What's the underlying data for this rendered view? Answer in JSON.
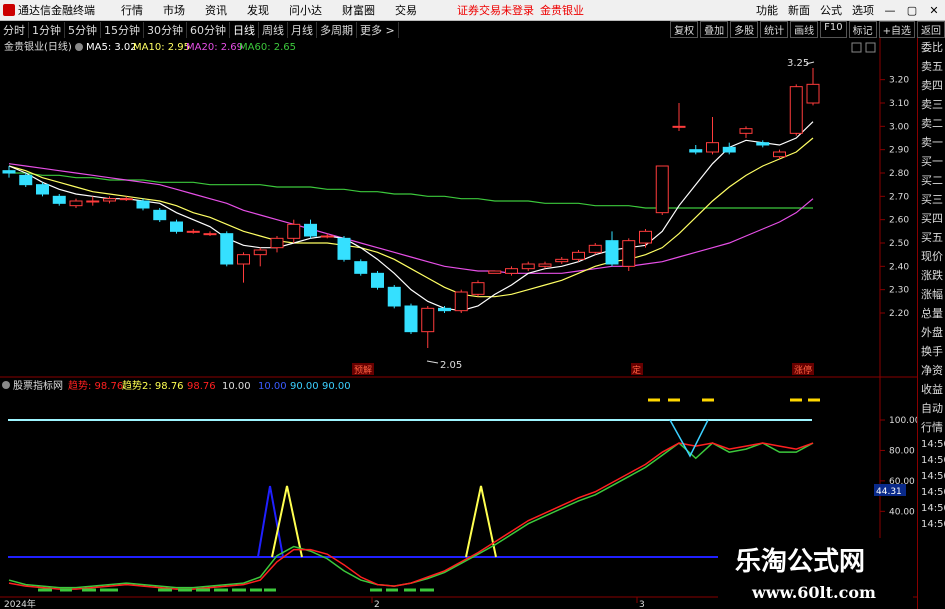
{
  "menubar": {
    "app_name": "通达信金融终端",
    "menus": [
      "行情",
      "市场",
      "资讯",
      "发现",
      "问小达",
      "财富圈",
      "交易"
    ],
    "alert": "证券交易未登录",
    "stock": "金贵银业",
    "right_menus": [
      "功能",
      "新面",
      "公式",
      "选项"
    ],
    "win_min": "—",
    "win_max": "▢",
    "win_close": "✕"
  },
  "periodbar": {
    "periods": [
      "分时",
      "1分钟",
      "5分钟",
      "15分钟",
      "30分钟",
      "60分钟",
      "日线",
      "周线",
      "月线",
      "多周期",
      "更多 >"
    ],
    "active": "日线",
    "right_tools": [
      "复权",
      "叠加",
      "多股",
      "统计",
      "画线",
      "F10",
      "标记",
      "+自选",
      "返回"
    ]
  },
  "main_chart_header": {
    "title": "金贵银业(日线)",
    "ma5": "MA5: 3.02",
    "ma10": "MA10: 2.95",
    "ma20": "MA20: 2.69",
    "ma60": "MA60: 2.65"
  },
  "main_chart_labels": {
    "high_marker": "3.25",
    "low_marker": "2.05",
    "tag1": "预解",
    "tag2": "定",
    "tag3": "涨停"
  },
  "price_axis": [
    "3.20",
    "3.10",
    "3.00",
    "2.90",
    "2.80",
    "2.70",
    "2.60",
    "2.50",
    "2.40",
    "2.30",
    "2.20"
  ],
  "indicator_header": {
    "title": "股票指标网",
    "t1_label": "趋势: 98.76",
    "t2_label": "趋势2: 98.76",
    "v1": "98.76",
    "v2": "10.00",
    "v3": "10.00",
    "v4": "90.00",
    "v5": "90.00"
  },
  "indicator_axis": [
    "100.00",
    "80.00",
    "60.00",
    "40.00"
  ],
  "indicator_readout": "44.31",
  "time_axis": [
    "2024年",
    "2",
    "3"
  ],
  "side_panel": {
    "top": "委比",
    "items": [
      "卖五",
      "卖四",
      "卖三",
      "卖二",
      "卖一",
      "买一",
      "买二",
      "买三",
      "买四",
      "买五",
      "现价",
      "涨跌",
      "涨幅",
      "总量",
      "外盘",
      "换手",
      "净资",
      "收益"
    ],
    "lower": [
      "自动",
      "行情"
    ],
    "times": [
      "14:50",
      "14:50",
      "14:50",
      "14:50",
      "14:50",
      "14:50"
    ]
  },
  "watermark": {
    "title": "乐淘公式网",
    "url": "www.60lt.com"
  },
  "colors": {
    "up": "#ff3c3c",
    "down": "#35e0ff",
    "ma5": "#ffffff",
    "ma10": "#ffff64",
    "ma20": "#e64fe6",
    "ma60": "#3cc83c",
    "trend": "#ff2020",
    "trend2": "#ffff50"
  },
  "chart_data": {
    "type": "candlestick",
    "price_range": [
      2.05,
      3.25
    ],
    "ohlc": [
      [
        2.81,
        2.83,
        2.78,
        2.8
      ],
      [
        2.79,
        2.8,
        2.74,
        2.75
      ],
      [
        2.75,
        2.76,
        2.7,
        2.71
      ],
      [
        2.7,
        2.71,
        2.66,
        2.67
      ],
      [
        2.66,
        2.69,
        2.65,
        2.68
      ],
      [
        2.68,
        2.7,
        2.66,
        2.68
      ],
      [
        2.68,
        2.7,
        2.67,
        2.69
      ],
      [
        2.69,
        2.7,
        2.68,
        2.69
      ],
      [
        2.68,
        2.69,
        2.64,
        2.65
      ],
      [
        2.64,
        2.65,
        2.59,
        2.6
      ],
      [
        2.59,
        2.6,
        2.54,
        2.55
      ],
      [
        2.55,
        2.56,
        2.54,
        2.55
      ],
      [
        2.54,
        2.55,
        2.53,
        2.54
      ],
      [
        2.54,
        2.55,
        2.4,
        2.41
      ],
      [
        2.41,
        2.46,
        2.33,
        2.45
      ],
      [
        2.45,
        2.48,
        2.4,
        2.47
      ],
      [
        2.48,
        2.53,
        2.46,
        2.52
      ],
      [
        2.52,
        2.6,
        2.5,
        2.58
      ],
      [
        2.58,
        2.6,
        2.52,
        2.53
      ],
      [
        2.53,
        2.54,
        2.52,
        2.53
      ],
      [
        2.52,
        2.53,
        2.42,
        2.43
      ],
      [
        2.42,
        2.43,
        2.36,
        2.37
      ],
      [
        2.37,
        2.38,
        2.3,
        2.31
      ],
      [
        2.31,
        2.32,
        2.22,
        2.23
      ],
      [
        2.23,
        2.24,
        2.11,
        2.12
      ],
      [
        2.12,
        2.23,
        2.05,
        2.22
      ],
      [
        2.22,
        2.23,
        2.2,
        2.21
      ],
      [
        2.21,
        2.3,
        2.2,
        2.29
      ],
      [
        2.28,
        2.34,
        2.27,
        2.33
      ],
      [
        2.37,
        2.38,
        2.37,
        2.38
      ],
      [
        2.37,
        2.4,
        2.36,
        2.39
      ],
      [
        2.39,
        2.42,
        2.38,
        2.41
      ],
      [
        2.4,
        2.42,
        2.39,
        2.41
      ],
      [
        2.42,
        2.44,
        2.41,
        2.43
      ],
      [
        2.43,
        2.47,
        2.42,
        2.46
      ],
      [
        2.46,
        2.5,
        2.45,
        2.49
      ],
      [
        2.51,
        2.55,
        2.4,
        2.41
      ],
      [
        2.4,
        2.52,
        2.38,
        2.51
      ],
      [
        2.5,
        2.56,
        2.48,
        2.55
      ],
      [
        2.63,
        2.83,
        2.62,
        2.83
      ],
      [
        3.0,
        3.1,
        2.98,
        3.0
      ],
      [
        2.9,
        2.92,
        2.88,
        2.89
      ],
      [
        2.89,
        3.04,
        2.88,
        2.93
      ],
      [
        2.91,
        2.93,
        2.88,
        2.89
      ],
      [
        2.97,
        3.0,
        2.95,
        2.99
      ],
      [
        2.93,
        2.94,
        2.91,
        2.92
      ],
      [
        2.87,
        2.9,
        2.86,
        2.89
      ],
      [
        2.97,
        3.18,
        2.96,
        3.17
      ],
      [
        3.1,
        3.25,
        3.09,
        3.18
      ]
    ],
    "ma5": [
      2.83,
      2.8,
      2.76,
      2.73,
      2.71,
      2.7,
      2.69,
      2.69,
      2.68,
      2.67,
      2.63,
      2.6,
      2.57,
      2.52,
      2.49,
      2.48,
      2.48,
      2.5,
      2.52,
      2.53,
      2.52,
      2.48,
      2.43,
      2.37,
      2.3,
      2.25,
      2.22,
      2.21,
      2.23,
      2.28,
      2.32,
      2.37,
      2.39,
      2.4,
      2.42,
      2.45,
      2.47,
      2.48,
      2.49,
      2.55,
      2.66,
      2.75,
      2.84,
      2.91,
      2.94,
      2.93,
      2.92,
      2.95,
      3.02
    ],
    "ma10": [
      2.83,
      2.81,
      2.78,
      2.76,
      2.74,
      2.72,
      2.71,
      2.7,
      2.69,
      2.68,
      2.66,
      2.63,
      2.61,
      2.58,
      2.55,
      2.53,
      2.51,
      2.5,
      2.5,
      2.5,
      2.49,
      2.48,
      2.46,
      2.43,
      2.39,
      2.35,
      2.31,
      2.28,
      2.27,
      2.27,
      2.28,
      2.3,
      2.32,
      2.34,
      2.37,
      2.4,
      2.42,
      2.43,
      2.45,
      2.48,
      2.54,
      2.61,
      2.68,
      2.74,
      2.79,
      2.83,
      2.86,
      2.89,
      2.95
    ],
    "ma20": [
      2.84,
      2.83,
      2.82,
      2.81,
      2.8,
      2.79,
      2.78,
      2.77,
      2.76,
      2.75,
      2.73,
      2.71,
      2.69,
      2.67,
      2.64,
      2.62,
      2.6,
      2.58,
      2.56,
      2.54,
      2.52,
      2.5,
      2.48,
      2.46,
      2.44,
      2.42,
      2.4,
      2.39,
      2.38,
      2.38,
      2.37,
      2.37,
      2.37,
      2.37,
      2.38,
      2.39,
      2.4,
      2.4,
      2.41,
      2.42,
      2.44,
      2.46,
      2.48,
      2.5,
      2.53,
      2.56,
      2.59,
      2.63,
      2.69
    ],
    "ma60": [
      2.8,
      2.8,
      2.79,
      2.79,
      2.78,
      2.78,
      2.77,
      2.77,
      2.77,
      2.76,
      2.76,
      2.76,
      2.75,
      2.75,
      2.75,
      2.75,
      2.74,
      2.74,
      2.74,
      2.73,
      2.73,
      2.72,
      2.72,
      2.71,
      2.71,
      2.7,
      2.7,
      2.69,
      2.69,
      2.68,
      2.68,
      2.68,
      2.67,
      2.67,
      2.67,
      2.66,
      2.66,
      2.66,
      2.65,
      2.65,
      2.65,
      2.65,
      2.65,
      2.65,
      2.65,
      2.65,
      2.65,
      2.65,
      2.65
    ],
    "trend": [
      6,
      4,
      3,
      2,
      2,
      3,
      4,
      5,
      4,
      3,
      2,
      2,
      3,
      4,
      5,
      8,
      20,
      28,
      28,
      25,
      18,
      10,
      5,
      4,
      6,
      10,
      14,
      20,
      26,
      33,
      40,
      47,
      52,
      57,
      62,
      66,
      72,
      78,
      84,
      92,
      98,
      96,
      98,
      94,
      96,
      98,
      96,
      94,
      98
    ],
    "trend2": [
      8,
      5,
      4,
      3,
      3,
      4,
      5,
      6,
      5,
      4,
      3,
      3,
      4,
      5,
      6,
      10,
      24,
      30,
      27,
      22,
      14,
      8,
      5,
      4,
      6,
      9,
      13,
      19,
      25,
      31,
      38,
      45,
      50,
      55,
      60,
      64,
      70,
      76,
      82,
      90,
      98,
      88,
      98,
      92,
      94,
      98,
      92,
      92,
      98
    ],
    "trend_range": [
      0,
      110
    ]
  }
}
